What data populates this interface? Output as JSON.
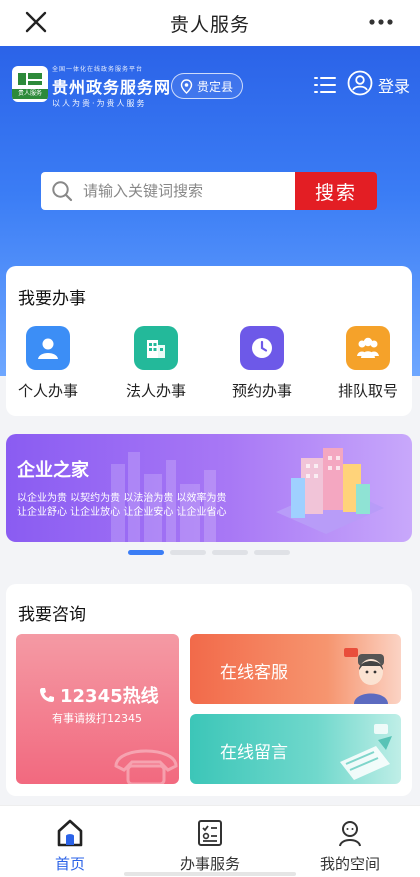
{
  "topbar": {
    "title": "贵人服务",
    "close_icon": "close-icon",
    "more_icon": "more-icon"
  },
  "header": {
    "logo_text": "贵人服务",
    "brand_small": "全国一体化在线政务服务平台",
    "brand_main": "贵州政务服务网",
    "brand_sub": "以人为贵·为贵人服务",
    "location": "贵定县",
    "login": "登录"
  },
  "search": {
    "placeholder": "请输入关键词搜索",
    "button": "搜索"
  },
  "services": {
    "title": "我要办事",
    "items": [
      {
        "label": "个人办事",
        "icon": "person-icon",
        "color": "#3c8ef6"
      },
      {
        "label": "法人办事",
        "icon": "building-icon",
        "color": "#23b99a"
      },
      {
        "label": "预约办事",
        "icon": "clock-icon",
        "color": "#6d59e8"
      },
      {
        "label": "排队取号",
        "icon": "group-icon",
        "color": "#f5a22a"
      }
    ]
  },
  "banner": {
    "title": "企业之家",
    "line1": "以企业为贵 以契约为贵 以法治为贵 以效率为贵",
    "line2": "让企业舒心 让企业放心 让企业安心 让企业省心",
    "active_page": 1,
    "pages": 4
  },
  "consult": {
    "title": "我要咨询",
    "hotline": "12345热线",
    "hotline_sub": "有事请拨打12345",
    "online_service": "在线客服",
    "online_message": "在线留言"
  },
  "tabs": [
    {
      "label": "首页",
      "icon": "home-icon",
      "active": true
    },
    {
      "label": "办事服务",
      "icon": "checklist-icon",
      "active": false
    },
    {
      "label": "我的空间",
      "icon": "profile-icon",
      "active": false
    }
  ],
  "colors": {
    "primary": "#2b63e8",
    "search_button": "#e31e24"
  }
}
